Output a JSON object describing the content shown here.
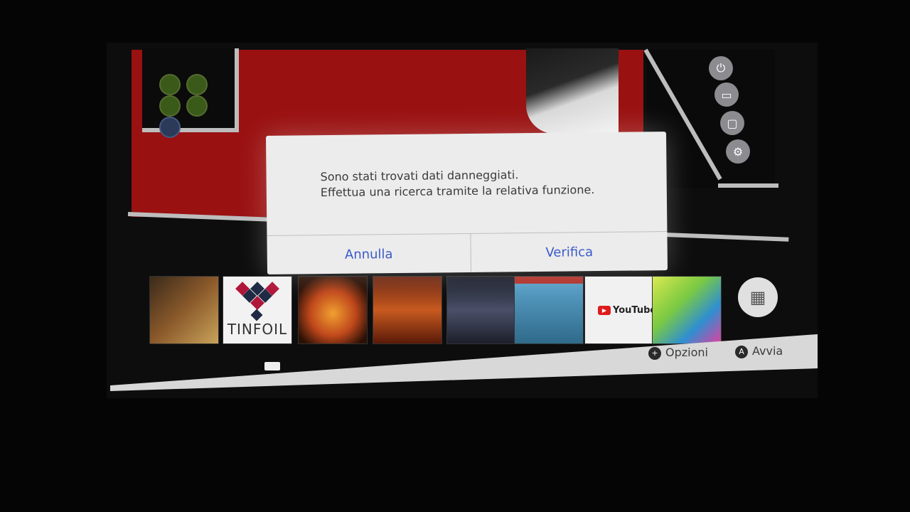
{
  "dialog": {
    "message_line1": "Sono stati trovati dati danneggiati.",
    "message_line2": "Effettua una ricerca tramite la relativa funzione.",
    "cancel_label": "Annulla",
    "verify_label": "Verifica"
  },
  "games": [
    {
      "name": "dragon-ball-xenoverse-2",
      "color": "#7a4a2a"
    },
    {
      "name": "tinfoil",
      "title": "TINFOIL",
      "color": "#f2f2f2"
    },
    {
      "name": "dragon-ball-fighterz",
      "color": "#c0481c"
    },
    {
      "name": "doom",
      "color": "#a13a12"
    },
    {
      "name": "game-5",
      "color": "#2b2f3c"
    },
    {
      "name": "dragon-quest",
      "color": "#3d7ea6"
    },
    {
      "name": "youtube",
      "title": "YouTube",
      "color": "#f1f1f1"
    },
    {
      "name": "splatoon-2",
      "color": "#7ac943"
    }
  ],
  "footer": {
    "options_glyph": "+",
    "options_label": "Opzioni",
    "start_glyph": "A",
    "start_label": "Avvia"
  },
  "side_icons": [
    "power-icon",
    "gallery-icon",
    "screen-icon",
    "settings-icon"
  ],
  "colors": {
    "theme_red": "#9a1111",
    "dialog_bg": "#ececec",
    "button_text": "#3a5ac8"
  }
}
